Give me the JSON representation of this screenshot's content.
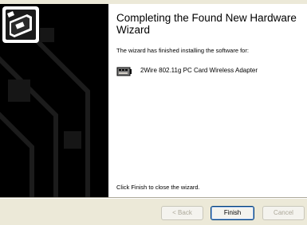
{
  "wizard": {
    "title": "Completing the Found New Hardware Wizard",
    "message": "The wizard has finished installing the software for:",
    "device_name": "2Wire 802.11g PC Card Wireless Adapter",
    "footer": "Click Finish to close the wizard."
  },
  "buttons": {
    "back": "< Back",
    "finish": "Finish",
    "cancel": "Cancel"
  },
  "icons": {
    "hardware": "hardware-wizard-icon",
    "device": "network-card-icon"
  }
}
